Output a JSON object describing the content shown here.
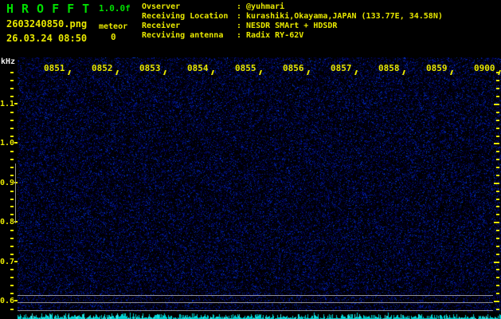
{
  "app": {
    "title": "HROFFT",
    "version": "1.0.0f"
  },
  "capture": {
    "filename": "2603240850.png",
    "datetime": "26.03.24 08:50",
    "counter_label": "meteor",
    "counter_value": "0"
  },
  "station": {
    "rows": [
      {
        "label": "Ovserver",
        "separator": ":",
        "value": "@yuhmari"
      },
      {
        "label": "Receiving Location",
        "separator": ":",
        "value": "kurashiki,Okayama,JAPAN (133.77E, 34.58N)"
      },
      {
        "label": "Receiver",
        "separator": ":",
        "value": "NESDR SMArt + HDSDR"
      },
      {
        "label": "Recviving antenna",
        "separator": ":",
        "value": "Radix RY-62V"
      }
    ]
  },
  "spectrogram": {
    "unit_label": "kHz",
    "time_labels": [
      "0851",
      "0852",
      "0853",
      "0854",
      "0855",
      "0856",
      "0857",
      "0858",
      "0859",
      "0900"
    ],
    "freq_labels": [
      "1.1",
      "1.0",
      "0.9",
      "0.8",
      "0.7",
      "0.6"
    ],
    "colors": {
      "label_yellow": "#e8e800",
      "title_green": "#00dd00",
      "unit_white": "#f0f0f0",
      "grid_gray": "#a8a8a8",
      "signal_cyan": "#00d2d2",
      "noise_blue": "#1a1ac8"
    }
  }
}
